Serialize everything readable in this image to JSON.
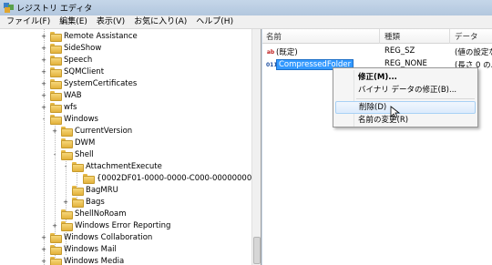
{
  "window": {
    "title": "レジストリ エディタ"
  },
  "menu": [
    "ファイル(F)",
    "編集(E)",
    "表示(V)",
    "お気に入り(A)",
    "ヘルプ(H)"
  ],
  "tree": [
    {
      "label": "Remote Assistance",
      "expand": "+"
    },
    {
      "label": "SideShow",
      "expand": "+"
    },
    {
      "label": "Speech",
      "expand": "+"
    },
    {
      "label": "SQMClient",
      "expand": "+"
    },
    {
      "label": "SystemCertificates",
      "expand": "+"
    },
    {
      "label": "WAB",
      "expand": "+"
    },
    {
      "label": "wfs",
      "expand": "+"
    },
    {
      "label": "Windows",
      "expand": "-"
    },
    {
      "label": "CurrentVersion",
      "expand": "+"
    },
    {
      "label": "DWM",
      "expand": ""
    },
    {
      "label": "Shell",
      "expand": "-"
    },
    {
      "label": "AttachmentExecute",
      "expand": "-"
    },
    {
      "label": "{0002DF01-0000-0000-C000-000000000046}",
      "expand": ""
    },
    {
      "label": "BagMRU",
      "expand": ""
    },
    {
      "label": "Bags",
      "expand": "+"
    },
    {
      "label": "ShellNoRoam",
      "expand": ""
    },
    {
      "label": "Windows Error Reporting",
      "expand": "+"
    },
    {
      "label": "Windows Collaboration",
      "expand": "+"
    },
    {
      "label": "Windows Mail",
      "expand": "+"
    },
    {
      "label": "Windows Media",
      "expand": "+"
    }
  ],
  "list": {
    "columns": [
      "名前",
      "種類",
      "データ"
    ],
    "rows": [
      {
        "icon": "ab",
        "name": "(既定)",
        "type": "REG_SZ",
        "data": "(値の設定な"
      },
      {
        "icon": "011",
        "name": "CompressedFolder",
        "type": "REG_NONE",
        "data": "(長さ 0 のバ"
      }
    ]
  },
  "context_menu": {
    "items": [
      "修正(M)...",
      "バイナリ データの修正(B)...",
      "削除(D)",
      "名前の変更(R)"
    ]
  }
}
